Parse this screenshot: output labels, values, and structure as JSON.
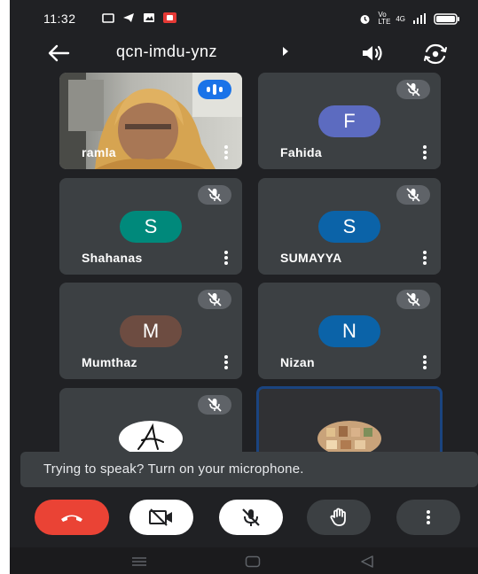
{
  "status_bar": {
    "time": "11:32",
    "network_label": "Vo LTE",
    "signal_label": "4G"
  },
  "meeting": {
    "code": "qcn-imdu-ynz"
  },
  "participants": [
    {
      "name": "ramla",
      "has_video": true,
      "muted": false,
      "speaking": true
    },
    {
      "name": "Fahida",
      "initial": "F",
      "avatar_color": "#5c6bc0",
      "muted": true
    },
    {
      "name": "Shahanas",
      "initial": "S",
      "avatar_color": "#00897b",
      "muted": true
    },
    {
      "name": "SUMAYYA",
      "initial": "S",
      "avatar_color": "#0b63a8",
      "muted": true
    },
    {
      "name": "Mumthaz",
      "initial": "M",
      "avatar_color": "#6d4c41",
      "muted": true
    },
    {
      "name": "Nizan",
      "initial": "N",
      "avatar_color": "#0b63a8",
      "muted": true
    },
    {
      "name": "",
      "has_image_avatar": true,
      "muted": true
    },
    {
      "name": "",
      "has_image_avatar": true,
      "self_highlighted": true
    }
  ],
  "toast": {
    "message": "Trying to speak? Turn on your microphone."
  },
  "controls": {
    "end_call_color": "#ea4335",
    "icons": [
      "end-call-icon",
      "camera-off-icon",
      "mic-off-icon",
      "raise-hand-icon",
      "more-options-icon"
    ]
  },
  "colors": {
    "background": "#202124",
    "tile": "#3c4043",
    "active_border": "#1a4480"
  }
}
